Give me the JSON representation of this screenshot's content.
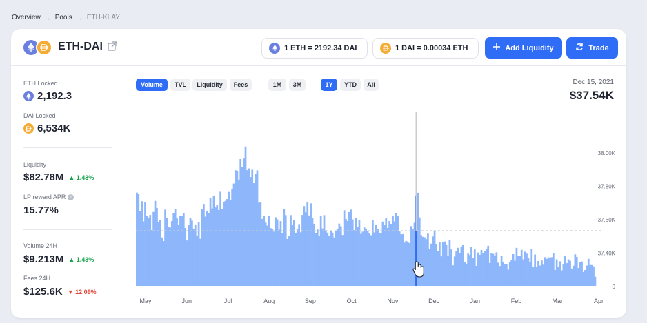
{
  "breadcrumb": {
    "items": [
      "Overview",
      "Pools"
    ],
    "current": "ETH-KLAY"
  },
  "pair": {
    "title": "ETH-DAI"
  },
  "rates": {
    "eth_to_dai": "1 ETH = 2192.34 DAI",
    "dai_to_eth": "1 DAI = 0.00034 ETH"
  },
  "buttons": {
    "add_liquidity": "Add Liquidity",
    "trade": "Trade"
  },
  "sidebar": {
    "eth_locked_label": "ETH Locked",
    "eth_locked_value": "2,192.3",
    "dai_locked_label": "DAI Locked",
    "dai_locked_value": "6,534K",
    "liquidity_label": "Liquidity",
    "liquidity_value": "$82.78M",
    "liquidity_delta": "▲ 1.43%",
    "apr_label": "LP reward APR",
    "apr_value": "15.77%",
    "volume_label": "Volume 24H",
    "volume_value": "$9.213M",
    "volume_delta": "▲ 1.43%",
    "fees_label": "Fees 24H",
    "fees_value": "$125.6K",
    "fees_delta": "▼ 12.09%"
  },
  "chart_tabs": [
    "Volume",
    "TVL",
    "Liquidity",
    "Fees"
  ],
  "range_tabs": [
    "1M",
    "3M",
    "1Y",
    "YTD",
    "All"
  ],
  "active_chart_tab": "Volume",
  "active_range_tab": "1Y",
  "hover": {
    "date": "Dec 15, 2021",
    "value": "$37.54K"
  },
  "icons": {
    "eth": "eth-icon",
    "dai": "dai-icon",
    "external": "external-link-icon",
    "plus": "plus-icon",
    "refresh": "refresh-icon",
    "cursor": "hand-cursor-icon",
    "info": "info-icon"
  },
  "colors": {
    "accent": "#2f6df6",
    "bar": "#8db6fb",
    "up": "#16a34a",
    "down": "#e5483b"
  },
  "chart_data": {
    "type": "bar",
    "x_tick_labels": [
      "May",
      "Jun",
      "Jul",
      "Aug",
      "Sep",
      "Oct",
      "Nov",
      "Dec",
      "Jan",
      "Feb",
      "Mar",
      "Apr"
    ],
    "y_tick_labels": [
      "0",
      "37.40K",
      "37.60K",
      "37.80K",
      "38.00K"
    ],
    "y_ticks": [
      37200,
      37400,
      37600,
      37800,
      38000
    ],
    "ylim": [
      37200,
      38100
    ],
    "reference_line": 37535,
    "highlight_index": 167,
    "values": [
      37763,
      37755,
      37653,
      37711,
      37590,
      37704,
      37624,
      37609,
      37629,
      37538,
      37647,
      37713,
      37671,
      37587,
      37597,
      37494,
      37472,
      37661,
      37609,
      37555,
      37553,
      37592,
      37638,
      37664,
      37608,
      37571,
      37621,
      37621,
      37639,
      37551,
      37476,
      37569,
      37611,
      37595,
      37547,
      37572,
      37503,
      37588,
      37486,
      37663,
      37695,
      37619,
      37650,
      37640,
      37729,
      37668,
      37742,
      37674,
      37688,
      37659,
      37768,
      37666,
      37704,
      37713,
      37724,
      37767,
      37716,
      37784,
      37817,
      37897,
      37891,
      37840,
      37964,
      37916,
      37967,
      38039,
      37897,
      37908,
      37856,
      37900,
      37819,
      37875,
      37896,
      37702,
      37704,
      37605,
      37622,
      37583,
      37565,
      37624,
      37550,
      37546,
      37529,
      37615,
      37602,
      37541,
      37592,
      37521,
      37666,
      37628,
      37485,
      37502,
      37628,
      37568,
      37599,
      37519,
      37545,
      37574,
      37525,
      37629,
      37682,
      37645,
      37707,
      37626,
      37698,
      37610,
      37576,
      37521,
      37542,
      37503,
      37625,
      37548,
      37628,
      37536,
      37523,
      37505,
      37535,
      37523,
      37494,
      37536,
      37546,
      37577,
      37561,
      37509,
      37657,
      37604,
      37592,
      37646,
      37661,
      37602,
      37538,
      37611,
      37556,
      37597,
      37515,
      37529,
      37554,
      37545,
      37533,
      37520,
      37508,
      37596,
      37524,
      37569,
      37544,
      37521,
      37520,
      37589,
      37569,
      37612,
      37551,
      37592,
      37576,
      37623,
      37590,
      37641,
      37622,
      37530,
      37513,
      37514,
      37463,
      37473,
      37469,
      37460,
      37562,
      37545,
      37582,
      37746,
      37762,
      37614,
      37508,
      37498,
      37495,
      37484,
      37517,
      37426,
      37457,
      37500,
      37537,
      37456,
      37412,
      37465,
      37381,
      37464,
      37470,
      37448,
      37386,
      37477,
      37422,
      37327,
      37380,
      37411,
      37432,
      37399,
      37440,
      37448,
      37345,
      37337,
      37397,
      37389,
      37437,
      37373,
      37422,
      37324,
      37404,
      37390,
      37419,
      37398,
      37413,
      37427,
      37444,
      37341,
      37399,
      37396,
      37384,
      37405,
      37343,
      37323,
      37384,
      37349,
      37332,
      37335,
      37301,
      37347,
      37357,
      37394,
      37355,
      37432,
      37382,
      37383,
      37420,
      37363,
      37409,
      37397,
      37373,
      37349,
      37423,
      37317,
      37392,
      37318,
      37353,
      37326,
      37356,
      37331,
      37376,
      37366,
      37375,
      37373,
      37376,
      37398,
      37299,
      37363,
      37316,
      37351,
      37297,
      37336,
      37386,
      37340,
      37363,
      37354,
      37308,
      37325,
      37393,
      37378,
      37311,
      37346,
      37350,
      37287,
      37299,
      37326,
      37366,
      37329,
      37329,
      37321,
      37259
    ]
  }
}
